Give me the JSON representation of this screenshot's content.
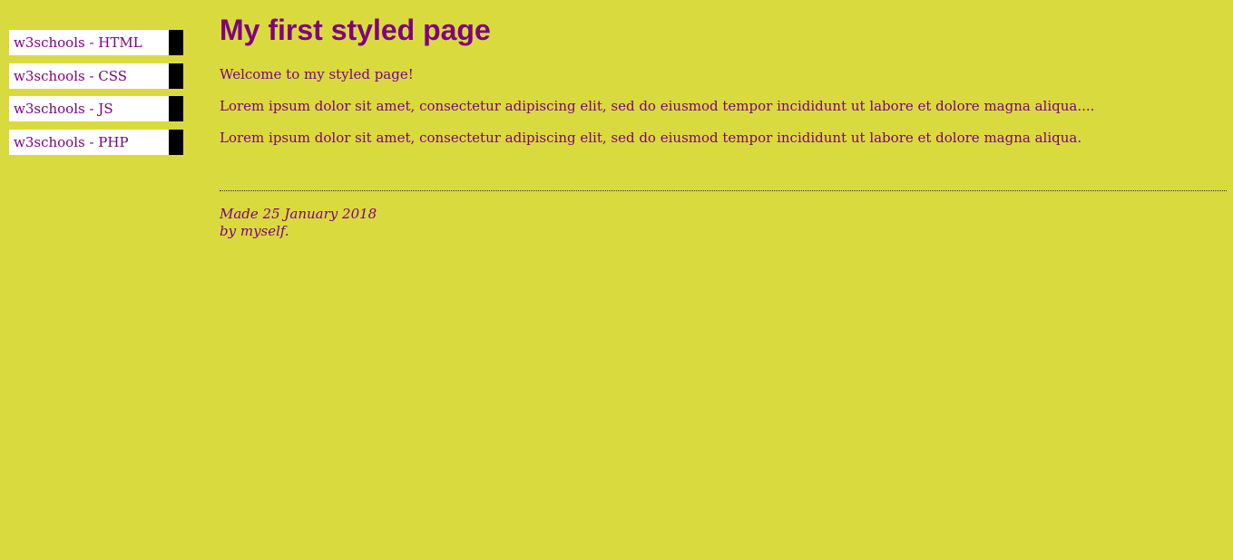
{
  "navigation": {
    "items": [
      {
        "label": "w3schools - HTML"
      },
      {
        "label": "w3schools - CSS"
      },
      {
        "label": "w3schools - JS"
      },
      {
        "label": "w3schools - PHP"
      }
    ]
  },
  "main": {
    "title": "My first styled page",
    "paragraphs": [
      "Welcome to my styled page!",
      "Lorem ipsum dolor sit amet, consectetur adipiscing elit, sed do eiusmod tempor incididunt ut labore et dolore magna aliqua....",
      "Lorem ipsum dolor sit amet, consectetur adipiscing elit, sed do eiusmod tempor incididunt ut labore et dolore magna aliqua."
    ]
  },
  "footer": {
    "line1": "Made 25 January 2018",
    "line2": "by myself."
  },
  "colors": {
    "background": "#d9da3e",
    "text": "#800080",
    "nav_background": "#ffffff",
    "nav_border": "#000000"
  }
}
